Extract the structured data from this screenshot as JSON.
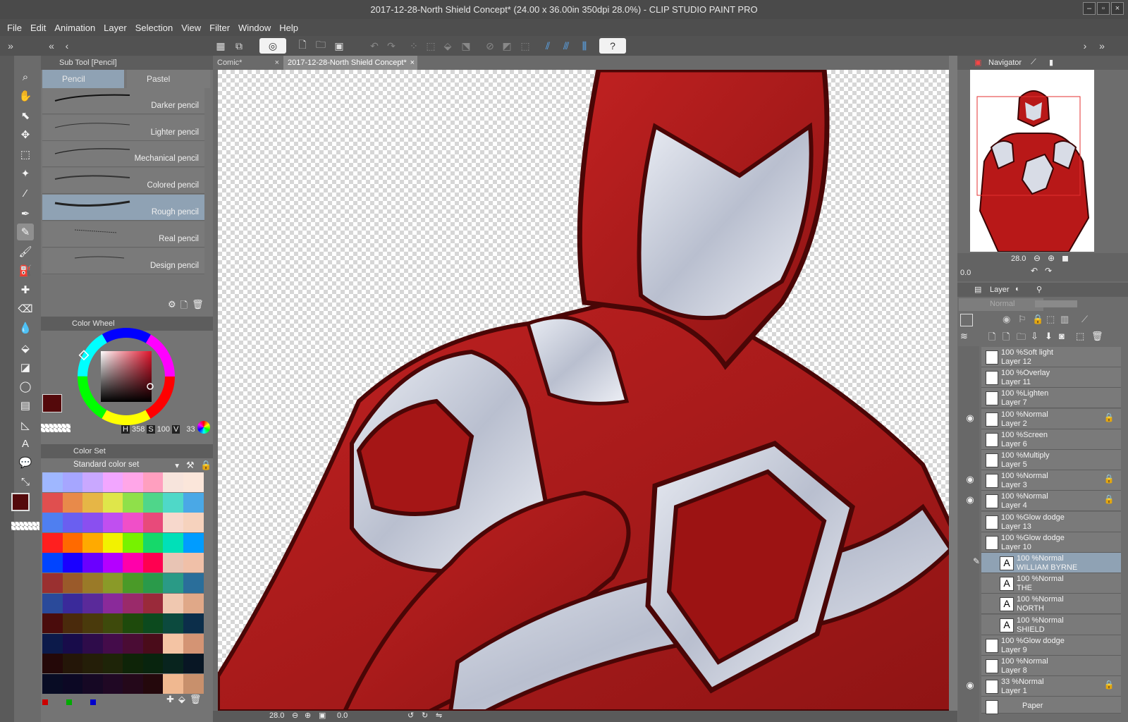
{
  "window": {
    "title": "2017-12-28-North Shield Concept* (24.00 x 36.00in 350dpi 28.0%)  - CLIP STUDIO PAINT PRO"
  },
  "menu": [
    "File",
    "Edit",
    "Animation",
    "Layer",
    "Selection",
    "View",
    "Filter",
    "Window",
    "Help"
  ],
  "subtool_panel": {
    "header": "Sub Tool [Pencil]",
    "tabs": [
      "Pencil",
      "Pastel"
    ],
    "brushes": [
      "Darker pencil",
      "Lighter pencil",
      "Mechanical pencil",
      "Colored pencil",
      "Rough pencil",
      "Real pencil",
      "Design pencil"
    ],
    "selected_brush": "Rough pencil"
  },
  "color_wheel": {
    "header": "Color Wheel",
    "h_label": "H",
    "h": "358",
    "s_label": "S",
    "s": "100",
    "v_label": "V",
    "v": "33",
    "main_color": "#54090b",
    "sub_color": "#0a1aff"
  },
  "color_set": {
    "header": "Color Set",
    "set_name": "Standard color set",
    "rows": [
      [
        "#9fb7ff",
        "#a6a6ff",
        "#c9a8ff",
        "#f2a6ff",
        "#ffa6e8",
        "#ff9fbf",
        "#f7e4dc",
        "#fbe6da"
      ],
      [
        "#e04f4f",
        "#e88a4a",
        "#e6b646",
        "#dfe64a",
        "#8fe04a",
        "#4fd68a",
        "#4fd8c8",
        "#4aa8e6"
      ],
      [
        "#4f7ff0",
        "#6a5ff0",
        "#8a4ff0",
        "#c04ff0",
        "#f04fc8",
        "#e84a7a",
        "#f7d8cc",
        "#f6d2bd"
      ],
      [
        "#ff1f1f",
        "#ff6a00",
        "#ffaa00",
        "#f2f200",
        "#77f200",
        "#16d86a",
        "#00e0b8",
        "#009cff"
      ],
      [
        "#0044ff",
        "#1a00ff",
        "#6a00ff",
        "#b400ff",
        "#ff00aa",
        "#ff0050",
        "#e8c4b4",
        "#f0c0a8"
      ],
      [
        "#9a3030",
        "#9a5a2a",
        "#9a7a28",
        "#8a9a28",
        "#4a9a28",
        "#2a9a4a",
        "#2a9a86",
        "#2a6e9a"
      ],
      [
        "#2a4a9a",
        "#3a2a9a",
        "#5a2a9a",
        "#8a2a9a",
        "#9a2a6a",
        "#9a2a3a",
        "#f0c8b0",
        "#e0a888"
      ],
      [
        "#4a0c0c",
        "#4a2a0c",
        "#4a3a0c",
        "#3e4a0c",
        "#1e4a0c",
        "#0c4a1e",
        "#0c4a3e",
        "#0c2e4a"
      ],
      [
        "#0c1a4a",
        "#180c4a",
        "#2e0c4a",
        "#440c4a",
        "#4a0c34",
        "#4a0c1a",
        "#f4c4a4",
        "#d49474"
      ],
      [
        "#240808",
        "#241608",
        "#241e08",
        "#1e2408",
        "#0e2408",
        "#08240e",
        "#08241e",
        "#081624"
      ],
      [
        "#080c24",
        "#0c0824",
        "#160824",
        "#200824",
        "#24081a",
        "#24080c",
        "#f0b890",
        "#c8906c"
      ]
    ]
  },
  "canvas": {
    "tabs": [
      "Comic*",
      "2017-12-28-North Shield Concept*"
    ],
    "zoom": "28.0",
    "angle": "0.0"
  },
  "navigator": {
    "header": "Navigator",
    "zoom": "28.0",
    "angle": "0.0"
  },
  "layer_panel": {
    "header": "Layer",
    "blend_mode": "Normal",
    "layers": [
      {
        "mode": "100 %Soft light",
        "name": "Layer 12",
        "visible": false,
        "locked": false,
        "selected": false,
        "icon": "raster"
      },
      {
        "mode": "100 %Overlay",
        "name": "Layer 11",
        "visible": false,
        "locked": false,
        "selected": false,
        "icon": "raster"
      },
      {
        "mode": "100 %Lighten",
        "name": "Layer 7",
        "visible": false,
        "locked": false,
        "selected": false,
        "icon": "raster"
      },
      {
        "mode": "100 %Normal",
        "name": "Layer 2",
        "visible": true,
        "locked": true,
        "selected": false,
        "icon": "raster"
      },
      {
        "mode": "100 %Screen",
        "name": "Layer 6",
        "visible": false,
        "locked": false,
        "selected": false,
        "icon": "raster"
      },
      {
        "mode": "100 %Multiply",
        "name": "Layer 5",
        "visible": false,
        "locked": false,
        "selected": false,
        "icon": "raster"
      },
      {
        "mode": "100 %Normal",
        "name": "Layer 3",
        "visible": true,
        "locked": true,
        "selected": false,
        "icon": "raster"
      },
      {
        "mode": "100 %Normal",
        "name": "Layer 4",
        "visible": true,
        "locked": true,
        "selected": false,
        "icon": "raster"
      },
      {
        "mode": "100 %Glow dodge",
        "name": "Layer 13",
        "visible": false,
        "locked": false,
        "selected": false,
        "icon": "raster"
      },
      {
        "mode": "100 %Glow dodge",
        "name": "Layer 10",
        "visible": false,
        "locked": false,
        "selected": false,
        "icon": "raster"
      },
      {
        "mode": "100 %Normal",
        "name": "WILLIAM BYRNE",
        "visible": false,
        "locked": false,
        "selected": true,
        "icon": "text"
      },
      {
        "mode": "100 %Normal",
        "name": "THE",
        "visible": false,
        "locked": false,
        "selected": false,
        "icon": "text"
      },
      {
        "mode": "100 %Normal",
        "name": "NORTH",
        "visible": false,
        "locked": false,
        "selected": false,
        "icon": "text"
      },
      {
        "mode": "100 %Normal",
        "name": "SHIELD",
        "visible": false,
        "locked": false,
        "selected": false,
        "icon": "text"
      },
      {
        "mode": "100 %Glow dodge",
        "name": "Layer 9",
        "visible": false,
        "locked": false,
        "selected": false,
        "icon": "raster"
      },
      {
        "mode": "100 %Normal",
        "name": "Layer 8",
        "visible": false,
        "locked": false,
        "selected": false,
        "icon": "raster"
      },
      {
        "mode": "33 %Normal",
        "name": "Layer 1",
        "visible": true,
        "locked": true,
        "selected": false,
        "icon": "raster"
      },
      {
        "mode": "",
        "name": "Paper",
        "visible": false,
        "locked": false,
        "selected": false,
        "icon": "paper"
      }
    ]
  }
}
